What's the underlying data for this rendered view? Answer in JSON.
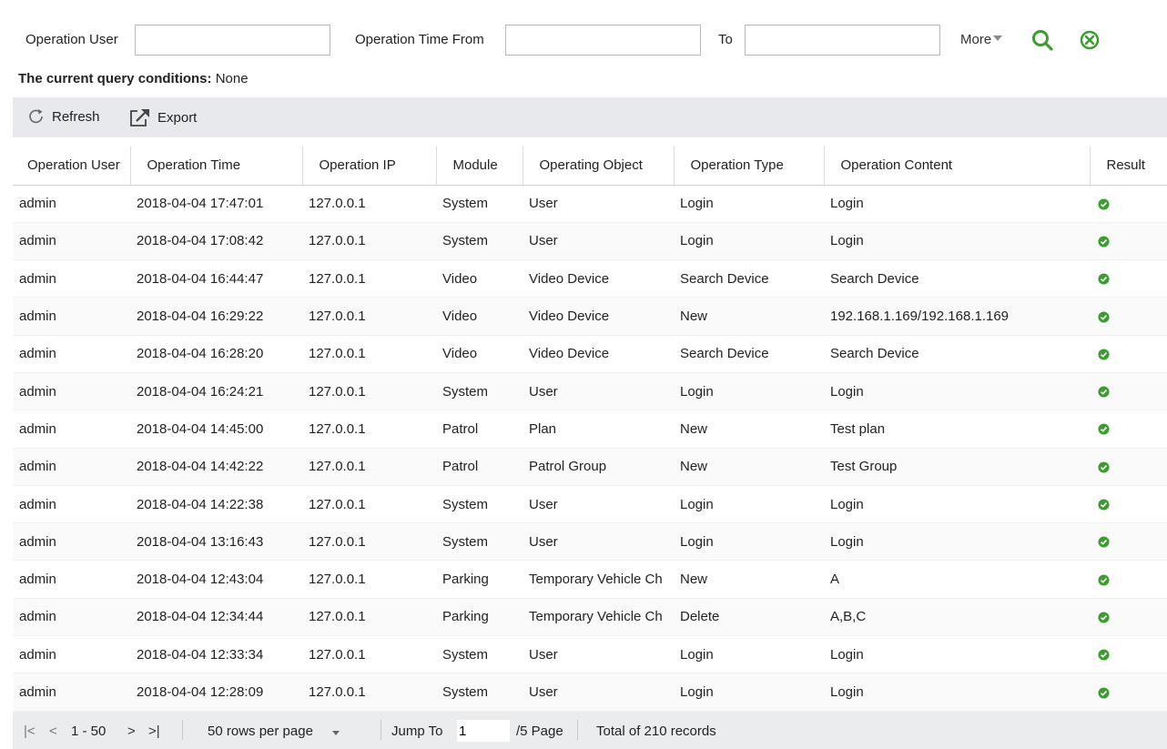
{
  "filter": {
    "operation_user_label": "Operation User",
    "operation_user_value": "",
    "time_from_label": "Operation Time From",
    "time_from_value": "",
    "to_label": "To",
    "to_value": "",
    "more_label": "More",
    "search_icon": "search-icon",
    "clear_icon": "clear-circle-icon"
  },
  "query": {
    "label": "The current query conditions:",
    "value": "None"
  },
  "toolbar": {
    "refresh_label": "Refresh",
    "export_label": "Export"
  },
  "table": {
    "columns": [
      "Operation User",
      "Operation Time",
      "Operation IP",
      "Module",
      "Operating Object",
      "Operation Type",
      "Operation Content",
      "Result"
    ],
    "rows": [
      [
        "admin",
        "2018-04-04 17:47:01",
        "127.0.0.1",
        "System",
        "User",
        "Login",
        "Login",
        "success"
      ],
      [
        "admin",
        "2018-04-04 17:08:42",
        "127.0.0.1",
        "System",
        "User",
        "Login",
        "Login",
        "success"
      ],
      [
        "admin",
        "2018-04-04 16:44:47",
        "127.0.0.1",
        "Video",
        "Video Device",
        "Search Device",
        "Search Device",
        "success"
      ],
      [
        "admin",
        "2018-04-04 16:29:22",
        "127.0.0.1",
        "Video",
        "Video Device",
        "New",
        "192.168.1.169/192.168.1.169",
        "success"
      ],
      [
        "admin",
        "2018-04-04 16:28:20",
        "127.0.0.1",
        "Video",
        "Video Device",
        "Search Device",
        "Search Device",
        "success"
      ],
      [
        "admin",
        "2018-04-04 16:24:21",
        "127.0.0.1",
        "System",
        "User",
        "Login",
        "Login",
        "success"
      ],
      [
        "admin",
        "2018-04-04 14:45:00",
        "127.0.0.1",
        "Patrol",
        "Plan",
        "New",
        "Test plan",
        "success"
      ],
      [
        "admin",
        "2018-04-04 14:42:22",
        "127.0.0.1",
        "Patrol",
        "Patrol Group",
        "New",
        "Test Group",
        "success"
      ],
      [
        "admin",
        "2018-04-04 14:22:38",
        "127.0.0.1",
        "System",
        "User",
        "Login",
        "Login",
        "success"
      ],
      [
        "admin",
        "2018-04-04 13:16:43",
        "127.0.0.1",
        "System",
        "User",
        "Login",
        "Login",
        "success"
      ],
      [
        "admin",
        "2018-04-04 12:43:04",
        "127.0.0.1",
        "Parking",
        "Temporary Vehicle Ch",
        "New",
        "A",
        "success"
      ],
      [
        "admin",
        "2018-04-04 12:34:44",
        "127.0.0.1",
        "Parking",
        "Temporary Vehicle Ch",
        "Delete",
        "A,B,C",
        "success"
      ],
      [
        "admin",
        "2018-04-04 12:33:34",
        "127.0.0.1",
        "System",
        "User",
        "Login",
        "Login",
        "success"
      ],
      [
        "admin",
        "2018-04-04 12:28:09",
        "127.0.0.1",
        "System",
        "User",
        "Login",
        "Login",
        "success"
      ]
    ],
    "result_icon": "check-circle-icon"
  },
  "pager": {
    "first": "|<",
    "prev": "<",
    "range": "1 - 50",
    "next": ">",
    "last": ">|",
    "rows_per_page": "50 rows per page",
    "jump_label": "Jump To",
    "jump_value": "1",
    "page_total": "/5 Page",
    "total": "Total of 210 records"
  },
  "colors": {
    "accent_green": "#3a9d2e",
    "toolbar_bg": "#e7e9ec",
    "pager_bg": "#eaecee"
  }
}
